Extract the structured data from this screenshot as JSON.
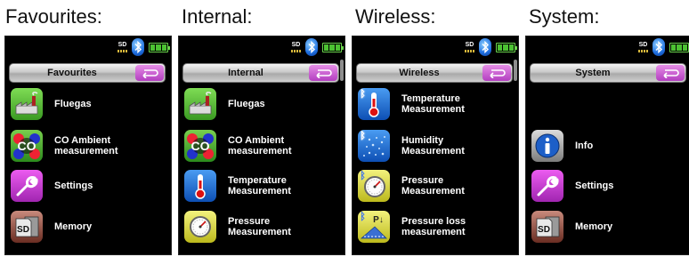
{
  "captions": [
    "Favourites:",
    "Internal:",
    "Wireless:",
    "System:"
  ],
  "status": {
    "sd_text": "SD"
  },
  "screens": [
    {
      "title": "Favourites",
      "scrollbar": false,
      "items": [
        {
          "label_line1": "Fluegas",
          "label_line2": "",
          "icon": "factory-chimney-icon"
        },
        {
          "label_line1": "CO Ambient",
          "label_line2": "measurement",
          "icon": "co-molecule-icon"
        },
        {
          "label_line1": "Settings",
          "label_line2": "",
          "icon": "wrench-icon"
        },
        {
          "label_line1": "Memory",
          "label_line2": "",
          "icon": "sd-card-memory-icon"
        }
      ]
    },
    {
      "title": "Internal",
      "scrollbar": true,
      "items": [
        {
          "label_line1": "Fluegas",
          "label_line2": "",
          "icon": "factory-chimney-icon"
        },
        {
          "label_line1": "CO Ambient",
          "label_line2": "measurement",
          "icon": "co-molecule-icon"
        },
        {
          "label_line1": "Temperature",
          "label_line2": "Measurement",
          "icon": "thermometer-icon"
        },
        {
          "label_line1": "Pressure",
          "label_line2": "Measurement",
          "icon": "pressure-gauge-icon"
        }
      ]
    },
    {
      "title": "Wireless",
      "scrollbar": true,
      "items": [
        {
          "label_line1": "Temperature",
          "label_line2": "Measurement",
          "icon": "wireless-thermometer-icon"
        },
        {
          "label_line1": "Humidity",
          "label_line2": "Measurement",
          "icon": "wireless-humidity-icon"
        },
        {
          "label_line1": "Pressure",
          "label_line2": "Measurement",
          "icon": "wireless-pressure-gauge-icon"
        },
        {
          "label_line1": "Pressure loss",
          "label_line2": "measurement",
          "icon": "wireless-pressure-loss-icon"
        }
      ]
    },
    {
      "title": "System",
      "scrollbar": false,
      "items": [
        {
          "label_line1": "Info",
          "label_line2": "",
          "icon": "info-icon"
        },
        {
          "label_line1": "Settings",
          "label_line2": "",
          "icon": "wrench-icon"
        },
        {
          "label_line1": "Memory",
          "label_line2": "",
          "icon": "sd-card-memory-icon"
        }
      ]
    }
  ],
  "icon_texts": {
    "co": "CO",
    "sd": "SD",
    "p_arrow": "P↓",
    "bt": "ᛒ"
  },
  "colors": {
    "screen_bg": "#000000",
    "back_button": "#c65ad2",
    "battery": "#4cc232",
    "bluetooth": "#1f6fe0"
  }
}
